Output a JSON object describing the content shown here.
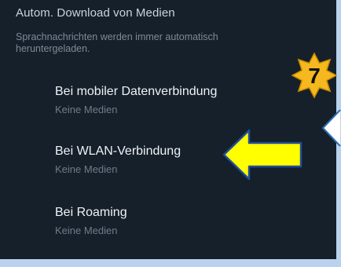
{
  "section": {
    "title": "Autom. Download von Medien",
    "description": "Sprachnachrichten werden immer automatisch heruntergeladen."
  },
  "items": [
    {
      "title": "Bei mobiler Datenverbindung",
      "subtitle": "Keine Medien"
    },
    {
      "title": "Bei WLAN-Verbindung",
      "subtitle": "Keine Medien"
    },
    {
      "title": "Bei Roaming",
      "subtitle": "Keine Medien"
    }
  ],
  "annotation": {
    "step_number": "7",
    "badge_color": "#f6b81f",
    "arrow_color": "#ffff00",
    "arrow_icon": "left-arrow-icon",
    "badge_icon": "starburst-badge-icon"
  },
  "colors": {
    "background": "#16202a",
    "frame": "#b9d3ee",
    "primary_text": "#eef3f7",
    "secondary_text": "#6e7c88"
  }
}
